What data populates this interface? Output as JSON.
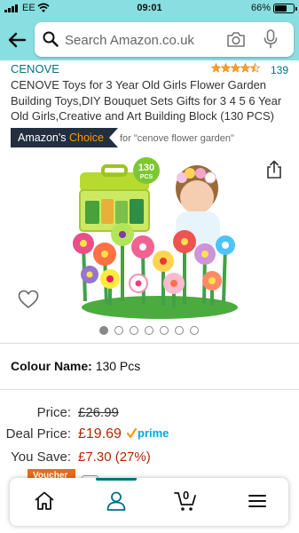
{
  "status_bar": {
    "carrier": "EE",
    "time": "09:01",
    "battery_percent": "66%",
    "battery_level": 0.66
  },
  "search": {
    "placeholder": "Search Amazon.co.uk",
    "icons": [
      "back-arrow-icon",
      "search-icon",
      "camera-icon",
      "microphone-icon"
    ]
  },
  "product": {
    "brand": "CENOVE",
    "rating": 4.5,
    "review_count": "139",
    "title": "CENOVE Toys for 3 Year Old Girls Flower Garden Building Toys,DIY Bouquet Sets Gifts for 3 4 5 6 Year Old Girls,Creative and Art Building Block (130 PCS)",
    "choice_badge_prefix": "Amazon's",
    "choice_badge_highlight": "Choice",
    "choice_for": "for \"cenove flower garden\"",
    "image_badge_count": "130",
    "image_badge_unit": "PCS",
    "image_count": 7,
    "active_image_index": 0,
    "colour_label": "Colour Name:",
    "colour_value": "130 Pcs"
  },
  "pricing": {
    "price_label": "Price:",
    "price_value": "£26.99",
    "deal_label": "Deal Price:",
    "deal_value": "£19.69",
    "prime_label": "prime",
    "save_label": "You Save:",
    "save_value": "£7.30 (27%)",
    "voucher_label": "Voucher"
  },
  "bottom_nav": {
    "items": [
      "home-icon",
      "account-icon",
      "cart-icon",
      "menu-icon"
    ],
    "active_item": "account-icon",
    "cart_count": "0"
  },
  "colors": {
    "header_bg": "#88dee0",
    "link": "#007185",
    "price_red": "#b12704",
    "prime_blue": "#00a8e1",
    "badge_dark": "#232f3e",
    "badge_orange": "#ff9900",
    "star": "#ffa41c"
  }
}
